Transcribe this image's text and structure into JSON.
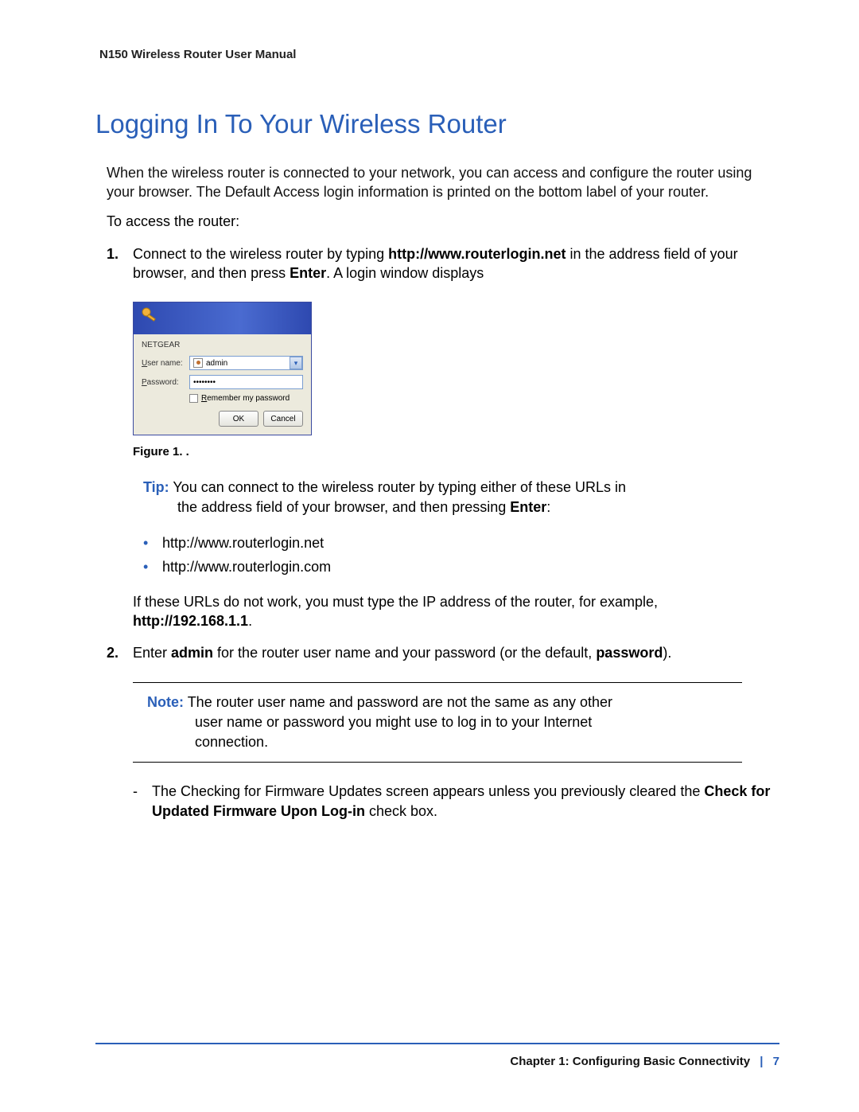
{
  "header_title": "N150 Wireless Router User Manual",
  "page_heading": "Logging In To Your Wireless Router",
  "intro_paragraph": "When the wireless router is connected to your network, you can access and configure the router using your browser. The Default Access login information is printed on the bottom label of your router.",
  "access_intro": "To access the router:",
  "step1": {
    "num": "1.",
    "prefix": "Connect to the wireless router by typing ",
    "url_bold": "http://www.routerlogin.net",
    "mid": " in the address field of your browser, and then press ",
    "enter_bold": "Enter",
    "suffix": ". A login window displays"
  },
  "dialog": {
    "brand": "NETGEAR",
    "username_label": "User name:",
    "username_value": "admin",
    "password_label": "Password:",
    "password_value": "••••••••",
    "remember_label": "Remember my password",
    "ok": "OK",
    "cancel": "Cancel"
  },
  "figure_caption": "Figure 1.  .",
  "tip": {
    "label": "Tip:",
    "line1": "You can connect to the wireless router by typing either of these URLs in",
    "line2": "the address field of your browser, and then pressing ",
    "enter_bold": "Enter",
    "colon": ":"
  },
  "urls": {
    "u1": "http://www.routerlogin.net",
    "u2": "http://www.routerlogin.com"
  },
  "ip_para": {
    "text": "If these URLs do not work, you must type the IP address of the router, for example, ",
    "ip_bold": "http://192.168.1.1",
    "dot": "."
  },
  "step2": {
    "num": "2.",
    "a": "Enter ",
    "admin_bold": "admin",
    "b": " for the router user name and your password (or the default, ",
    "pw_bold": "password",
    "c": ")."
  },
  "note": {
    "label": "Note:",
    "line1": "The router user name and password are not the same as any other",
    "line2": "user name or password you might use to log in to your Internet",
    "line3": "connection."
  },
  "dash_item": {
    "a": "The Checking for Firmware Updates screen appears unless you previously cleared the ",
    "bold": "Check for Updated Firmware Upon Log-in",
    "b": " check box."
  },
  "footer": {
    "chapter": "Chapter 1:  Configuring Basic Connectivity",
    "page": "7"
  }
}
